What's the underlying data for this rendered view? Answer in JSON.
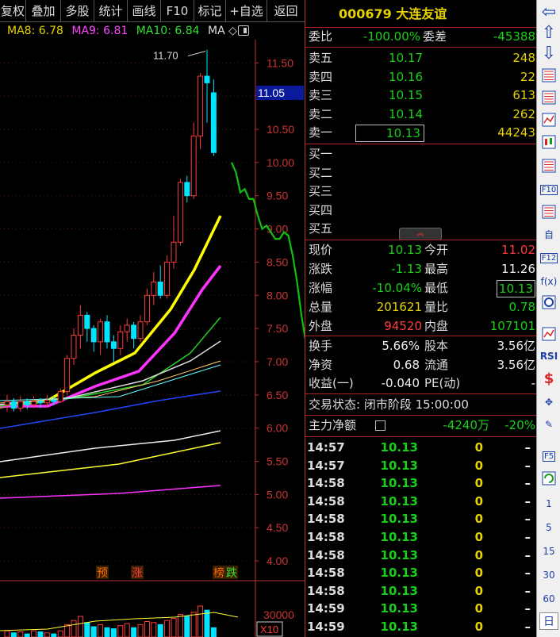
{
  "toolbar": {
    "items": [
      "复权",
      "叠加",
      "多股",
      "统计",
      "画线",
      "F10",
      "标记",
      "+自选",
      "返回"
    ]
  },
  "ma_legend": {
    "ma8": "MA8: 6.78",
    "ma9": "MA9: 6.81",
    "ma10": "MA10: 6.84",
    "ma": "MA ◇",
    "ma8_color": "#e6d200",
    "ma9_color": "#ff44ff",
    "ma10_color": "#33e033"
  },
  "chart_data": {
    "type": "candlestick",
    "price_ticks": [
      "11.50",
      "11.00",
      "10.50",
      "10.00",
      "9.50",
      "9.00",
      "8.50",
      "8.00",
      "7.50",
      "7.00",
      "6.50",
      "6.00",
      "5.50",
      "5.00",
      "4.50",
      "4.00"
    ],
    "price_range": [
      3.75,
      11.85
    ],
    "current_price_tag": "11.05",
    "high_annotation": "11.70",
    "markers": [
      {
        "label": "预",
        "color": "#ff6a00"
      },
      {
        "label": "涨",
        "color": "#ff3b3b"
      },
      {
        "label": "榜",
        "color": "#ff6a00"
      },
      {
        "label": "跌",
        "color": "#33e033"
      }
    ],
    "volume_tick": "30000",
    "volume_unit": "X10",
    "candles": [
      {
        "o": 6.35,
        "c": 6.4,
        "h": 6.5,
        "l": 6.25
      },
      {
        "o": 6.4,
        "c": 6.3,
        "h": 6.45,
        "l": 6.25
      },
      {
        "o": 6.3,
        "c": 6.4,
        "h": 6.48,
        "l": 6.25
      },
      {
        "o": 6.4,
        "c": 6.35,
        "h": 6.45,
        "l": 6.28
      },
      {
        "o": 6.35,
        "c": 6.4,
        "h": 6.48,
        "l": 6.3
      },
      {
        "o": 6.4,
        "c": 6.38,
        "h": 6.45,
        "l": 6.3
      },
      {
        "o": 6.38,
        "c": 6.42,
        "h": 6.5,
        "l": 6.32
      },
      {
        "o": 6.42,
        "c": 6.4,
        "h": 6.48,
        "l": 6.35
      },
      {
        "o": 6.4,
        "c": 6.55,
        "h": 6.6,
        "l": 6.38
      },
      {
        "o": 6.55,
        "c": 7.05,
        "h": 7.1,
        "l": 6.5
      },
      {
        "o": 7.05,
        "c": 7.4,
        "h": 7.5,
        "l": 6.95
      },
      {
        "o": 7.4,
        "c": 7.7,
        "h": 7.85,
        "l": 7.2
      },
      {
        "o": 7.7,
        "c": 7.5,
        "h": 7.75,
        "l": 7.3
      },
      {
        "o": 7.5,
        "c": 7.3,
        "h": 7.55,
        "l": 7.15
      },
      {
        "o": 7.3,
        "c": 7.6,
        "h": 7.65,
        "l": 7.1
      },
      {
        "o": 7.6,
        "c": 7.3,
        "h": 7.7,
        "l": 7.2
      },
      {
        "o": 7.3,
        "c": 7.2,
        "h": 7.4,
        "l": 7.0
      },
      {
        "o": 7.2,
        "c": 7.45,
        "h": 7.55,
        "l": 7.1
      },
      {
        "o": 7.45,
        "c": 7.55,
        "h": 7.65,
        "l": 7.3
      },
      {
        "o": 7.55,
        "c": 7.35,
        "h": 7.6,
        "l": 7.2
      },
      {
        "o": 7.35,
        "c": 7.6,
        "h": 7.7,
        "l": 7.3
      },
      {
        "o": 7.6,
        "c": 8.0,
        "h": 8.1,
        "l": 7.55
      },
      {
        "o": 8.0,
        "c": 8.2,
        "h": 8.35,
        "l": 7.85
      },
      {
        "o": 8.2,
        "c": 8.0,
        "h": 8.45,
        "l": 7.95
      },
      {
        "o": 8.0,
        "c": 8.5,
        "h": 8.6,
        "l": 7.95
      },
      {
        "o": 8.5,
        "c": 8.8,
        "h": 9.2,
        "l": 8.4
      },
      {
        "o": 8.8,
        "c": 9.7,
        "h": 9.75,
        "l": 8.75
      },
      {
        "o": 9.7,
        "c": 9.5,
        "h": 9.8,
        "l": 9.4
      },
      {
        "o": 9.5,
        "c": 10.4,
        "h": 10.6,
        "l": 9.45
      },
      {
        "o": 10.4,
        "c": 11.3,
        "h": 11.35,
        "l": 10.2
      },
      {
        "o": 11.3,
        "c": 11.2,
        "h": 11.7,
        "l": 10.6
      },
      {
        "o": 11.05,
        "c": 10.15,
        "h": 11.25,
        "l": 10.1
      }
    ],
    "intraday_line": [
      10.0,
      9.85,
      9.55,
      9.6,
      9.45,
      9.45,
      9.2,
      9.0,
      9.05,
      8.95,
      8.85,
      8.85,
      8.95,
      8.9,
      8.6,
      8.2,
      7.7,
      7.3
    ]
  },
  "quote": {
    "code_name": "000679 大连友谊",
    "weibi_label": "委比",
    "weibi_value": "-100.00%",
    "weicha_label": "委差",
    "weicha_value": "-45388",
    "asks": [
      {
        "label": "卖五",
        "price": "10.17",
        "vol": "248"
      },
      {
        "label": "卖四",
        "price": "10.16",
        "vol": "22"
      },
      {
        "label": "卖三",
        "price": "10.15",
        "vol": "613"
      },
      {
        "label": "卖二",
        "price": "10.14",
        "vol": "262"
      },
      {
        "label": "卖一",
        "price": "10.13",
        "vol": "44243"
      }
    ],
    "bids": [
      {
        "label": "买一"
      },
      {
        "label": "买二"
      },
      {
        "label": "买三"
      },
      {
        "label": "买四"
      },
      {
        "label": "买五"
      }
    ],
    "stats": [
      {
        "l1": "现价",
        "v1": "10.13",
        "c1": "g",
        "l2": "今开",
        "v2": "11.02",
        "c2": "r"
      },
      {
        "l1": "涨跌",
        "v1": "-1.13",
        "c1": "g",
        "l2": "最高",
        "v2": "11.26",
        "c2": "w"
      },
      {
        "l1": "涨幅",
        "v1": "-10.04%",
        "c1": "g",
        "l2": "最低",
        "v2": "10.13",
        "c2": "g"
      },
      {
        "l1": "总量",
        "v1": "201621",
        "c1": "y",
        "l2": "量比",
        "v2": "0.78",
        "c2": "g"
      },
      {
        "l1": "外盘",
        "v1": "94520",
        "c1": "r",
        "l2": "内盘",
        "v2": "107101",
        "c2": "g"
      }
    ],
    "fund": [
      {
        "l1": "换手",
        "v1": "5.66%",
        "l2": "股本",
        "v2": "3.56亿"
      },
      {
        "l1": "净资",
        "v1": "0.68",
        "l2": "流通",
        "v2": "3.56亿"
      },
      {
        "l1": "收益(一)",
        "v1": "-0.040",
        "l2": "PE(动)",
        "v2": "-"
      }
    ],
    "trade_status": "交易状态: 闭市阶段 15:00:00",
    "main_flow_label": "主力净额",
    "main_flow_value": "-4240万",
    "main_flow_pct": "-20%",
    "ticks": [
      {
        "t": "14:57",
        "p": "10.13",
        "v": "0",
        "d": "–"
      },
      {
        "t": "14:57",
        "p": "10.13",
        "v": "0",
        "d": "–"
      },
      {
        "t": "14:58",
        "p": "10.13",
        "v": "0",
        "d": "–"
      },
      {
        "t": "14:58",
        "p": "10.13",
        "v": "0",
        "d": "–"
      },
      {
        "t": "14:58",
        "p": "10.13",
        "v": "0",
        "d": "–"
      },
      {
        "t": "14:58",
        "p": "10.13",
        "v": "0",
        "d": "–"
      },
      {
        "t": "14:58",
        "p": "10.13",
        "v": "0",
        "d": "–"
      },
      {
        "t": "14:58",
        "p": "10.13",
        "v": "0",
        "d": "–"
      },
      {
        "t": "14:58",
        "p": "10.13",
        "v": "0",
        "d": "–"
      },
      {
        "t": "14:59",
        "p": "10.13",
        "v": "0",
        "d": "–"
      },
      {
        "t": "14:59",
        "p": "10.13",
        "v": "0",
        "d": "–"
      }
    ]
  },
  "side_toolbar": {
    "items": [
      {
        "name": "left-arrow-icon",
        "text": "⇦"
      },
      {
        "name": "up-arrow-icon",
        "text": "⇧"
      },
      {
        "name": "down-arrow-icon",
        "text": "⇩"
      },
      {
        "name": "chart-settings-icon",
        "text": ""
      },
      {
        "name": "grid-report-icon",
        "text": ""
      },
      {
        "name": "line-chart-icon",
        "text": ""
      },
      {
        "name": "candle-chart-icon",
        "text": ""
      },
      {
        "name": "list-window-icon",
        "text": ""
      },
      {
        "name": "f10-icon",
        "text": "F10"
      },
      {
        "name": "info-page-icon",
        "text": ""
      },
      {
        "name": "self-select-icon",
        "text": "自"
      },
      {
        "name": "f12-icon",
        "text": "F12"
      },
      {
        "name": "formula-icon",
        "text": "f(x)"
      },
      {
        "name": "ring-icon",
        "text": ""
      },
      {
        "name": "wave-icon",
        "text": ""
      },
      {
        "name": "rsi-icon",
        "text": "RSI"
      },
      {
        "name": "dollar-icon",
        "text": "$"
      },
      {
        "name": "move-icon",
        "text": "✥"
      },
      {
        "name": "pencil-icon",
        "text": "✎"
      },
      {
        "name": "f5-icon",
        "text": "F5"
      },
      {
        "name": "refresh-icon",
        "text": ""
      },
      {
        "name": "period-1-button",
        "text": "1"
      },
      {
        "name": "period-5-button",
        "text": "5"
      },
      {
        "name": "period-15-button",
        "text": "15"
      },
      {
        "name": "period-30-button",
        "text": "30"
      },
      {
        "name": "period-60-button",
        "text": "60"
      },
      {
        "name": "period-day-button",
        "text": "日"
      }
    ]
  }
}
